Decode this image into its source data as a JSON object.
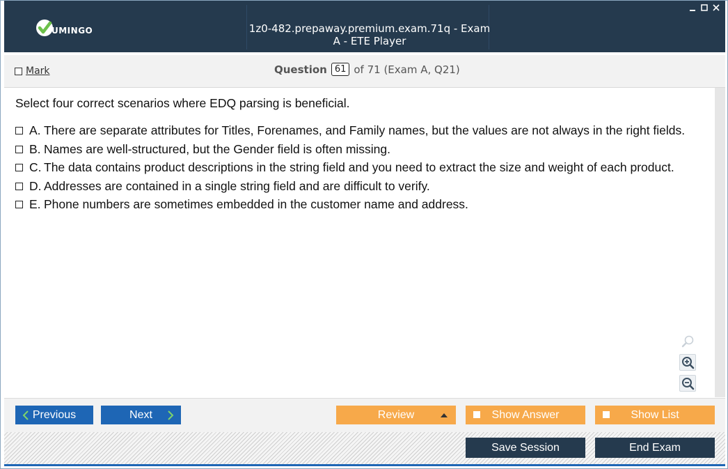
{
  "window": {
    "title": "1z0-482.prepaway.premium.exam.71q - Exam A - ETE Player",
    "logo_text": "UMINGO"
  },
  "header": {
    "mark_label": "Mark",
    "question_word": "Question",
    "question_number": "61",
    "question_of": "of 71 (Exam A, Q21)"
  },
  "question": {
    "text": "Select four correct scenarios where EDQ parsing is beneficial.",
    "options": [
      {
        "letter": "A.",
        "text": "There are separate attributes for Titles, Forenames, and Family names, but the values are not always in the right fields."
      },
      {
        "letter": "B.",
        "text": "Names are well-structured, but the Gender field is often missing."
      },
      {
        "letter": "C.",
        "text": "The data contains product descriptions in the string field and you need to extract the size and weight of each product."
      },
      {
        "letter": "D.",
        "text": "Addresses are contained in a single string field and are difficult to verify."
      },
      {
        "letter": "E.",
        "text": "Phone numbers are sometimes embedded in the customer name and address."
      }
    ]
  },
  "nav": {
    "previous": "Previous",
    "next": "Next",
    "review": "Review",
    "show_answer": "Show Answer",
    "show_list": "Show List",
    "save_session": "Save Session",
    "end_exam": "End Exam"
  },
  "icons": {
    "zoom_reset": "magnifier-icon",
    "zoom_in": "zoom-in-icon",
    "zoom_out": "zoom-out-icon"
  },
  "colors": {
    "titlebar": "#253a4e",
    "nav_blue": "#1e66b5",
    "orange": "#f7a94a",
    "logo_green": "#6cc04a"
  }
}
